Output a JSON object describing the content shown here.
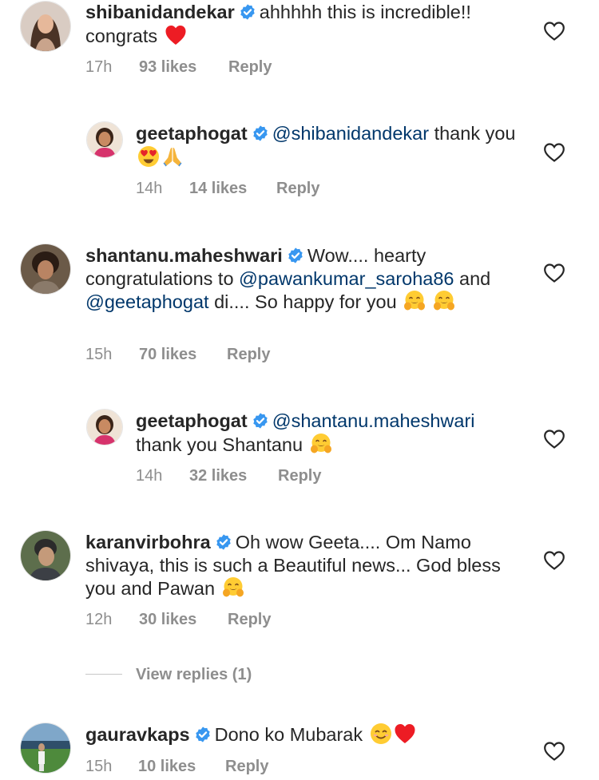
{
  "comments": [
    {
      "username": "shibanidandekar",
      "text_before": "ahhhhh this is incredible!! congrats",
      "mention": "",
      "text_after": "",
      "emojis": [
        "red-heart"
      ],
      "time": "17h",
      "likes": "93 likes",
      "reply": "Reply"
    },
    {
      "username": "geetaphogat",
      "text_before": "",
      "mention": "@shibanidandekar",
      "text_after": "thank you",
      "emojis": [
        "heart-eyes",
        "folded-hands"
      ],
      "time": "14h",
      "likes": "14 likes",
      "reply": "Reply"
    },
    {
      "username": "shantanu.maheshwari",
      "text_before": "Wow.... hearty congratulations to",
      "mention": "@pawankumar_saroha86",
      "mid": "and",
      "mention2": "@geetaphogat",
      "text_after": "di.... So happy for you",
      "emojis": [
        "hugging",
        "hugging"
      ],
      "time": "15h",
      "likes": "70 likes",
      "reply": "Reply"
    },
    {
      "username": "geetaphogat",
      "text_before": "",
      "mention": "@shantanu.maheshwari",
      "text_after": "thank you Shantanu",
      "emojis": [
        "hugging"
      ],
      "time": "14h",
      "likes": "32 likes",
      "reply": "Reply"
    },
    {
      "username": "karanvirbohra",
      "text_before": "Oh wow Geeta.... Om Namo shivaya, this is such a Beautiful news... God bless you and Pawan",
      "mention": "",
      "text_after": "",
      "emojis": [
        "hugging"
      ],
      "time": "12h",
      "likes": "30 likes",
      "reply": "Reply"
    },
    {
      "username": "gauravkaps",
      "text_before": "Dono ko Mubarak",
      "mention": "",
      "text_after": "",
      "emojis": [
        "smiling",
        "red-heart"
      ],
      "time": "15h",
      "likes": "10 likes",
      "reply": "Reply"
    }
  ],
  "view_replies": "View replies (1)",
  "colors": {
    "text": "#262626",
    "meta": "#8e8e8e",
    "mention": "#00376b",
    "verified": "#3897f0",
    "heart_red": "#ed1c24"
  }
}
